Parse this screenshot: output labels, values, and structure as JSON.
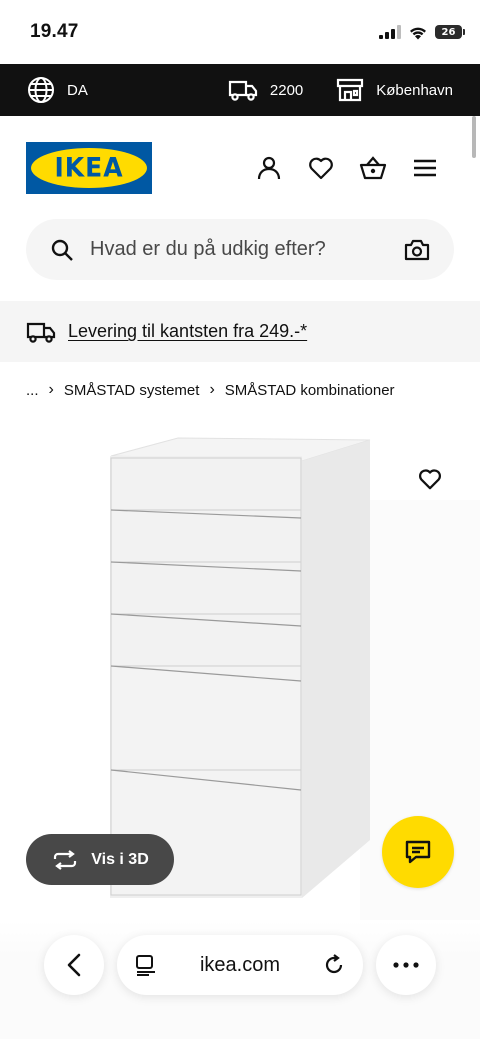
{
  "status": {
    "time": "19.47",
    "battery": "26"
  },
  "topbar": {
    "language": "DA",
    "zip": "2200",
    "store": "København"
  },
  "header": {
    "logo": "IKEA",
    "icons": [
      "profile-icon",
      "heart-icon",
      "basket-icon",
      "menu-icon"
    ]
  },
  "search": {
    "placeholder": "Hvad er du på udkig efter?"
  },
  "delivery": {
    "text": "Levering til kantsten fra 249.-*"
  },
  "breadcrumb": {
    "items": [
      "...",
      "SMÅSTAD systemet",
      "SMÅSTAD kombinationer"
    ]
  },
  "product": {
    "view3d_label": "Vis i 3D"
  },
  "browser": {
    "url": "ikea.com"
  },
  "colors": {
    "ikea_blue": "#0058a3",
    "ikea_yellow": "#ffdb00",
    "dark": "#111111"
  }
}
